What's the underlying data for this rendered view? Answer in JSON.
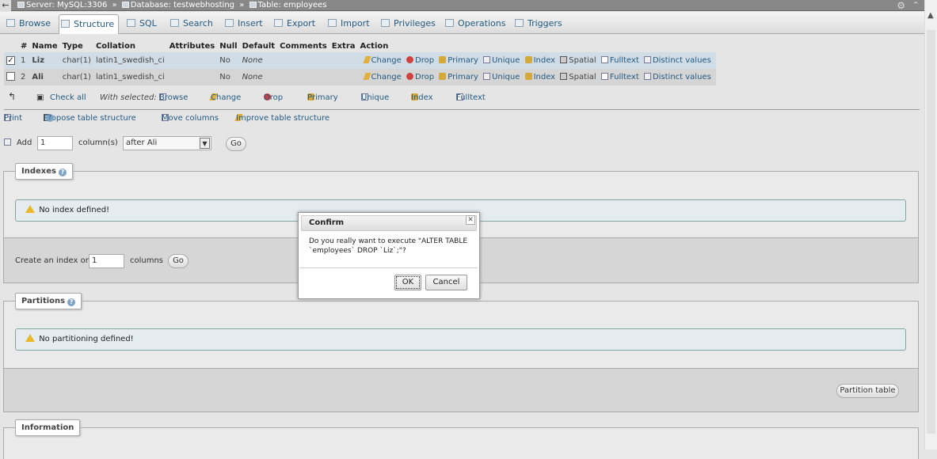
{
  "breadcrumb": {
    "back": "←",
    "server": "Server: MySQL:3306",
    "database": "Database: testwebhosting",
    "table": "Table: employees",
    "sep": "»"
  },
  "tabs": [
    {
      "label": "Browse",
      "icon": "browse-icon"
    },
    {
      "label": "Structure",
      "icon": "structure-icon",
      "active": true
    },
    {
      "label": "SQL",
      "icon": "sql-icon"
    },
    {
      "label": "Search",
      "icon": "search-icon"
    },
    {
      "label": "Insert",
      "icon": "insert-icon"
    },
    {
      "label": "Export",
      "icon": "export-icon"
    },
    {
      "label": "Import",
      "icon": "import-icon"
    },
    {
      "label": "Privileges",
      "icon": "privileges-icon"
    },
    {
      "label": "Operations",
      "icon": "operations-icon"
    },
    {
      "label": "Triggers",
      "icon": "triggers-icon"
    }
  ],
  "columns_table": {
    "headers": [
      "#",
      "Name",
      "Type",
      "Collation",
      "Attributes",
      "Null",
      "Default",
      "Comments",
      "Extra",
      "Action"
    ],
    "rows": [
      {
        "checked": true,
        "num": "1",
        "name": "Liz",
        "type": "char(1)",
        "collation": "latin1_swedish_ci",
        "attributes": "",
        "null": "No",
        "default": "None",
        "comments": "",
        "extra": ""
      },
      {
        "checked": false,
        "num": "2",
        "name": "Ali",
        "type": "char(1)",
        "collation": "latin1_swedish_ci",
        "attributes": "",
        "null": "No",
        "default": "None",
        "comments": "",
        "extra": ""
      }
    ],
    "actions": {
      "change": "Change",
      "drop": "Drop",
      "primary": "Primary",
      "unique": "Unique",
      "index": "Index",
      "spatial": "Spatial",
      "fulltext": "Fulltext",
      "distinct": "Distinct values"
    }
  },
  "with_selected": {
    "check_all": "Check all",
    "label": "With selected:",
    "browse": "Browse",
    "change": "Change",
    "drop": "Drop",
    "primary": "Primary",
    "unique": "Unique",
    "index": "Index",
    "fulltext": "Fulltext"
  },
  "tools": {
    "print": "Print",
    "propose": "Propose table structure",
    "move": "Move columns",
    "improve": "Improve table structure"
  },
  "add_columns": {
    "label": "Add",
    "count": "1",
    "unit": "column(s)",
    "position": "after Ali",
    "go": "Go"
  },
  "indexes": {
    "legend": "Indexes",
    "notice": "No index defined!",
    "create_label": "Create an index on",
    "create_count": "1",
    "create_unit": "columns",
    "go": "Go"
  },
  "partitions": {
    "legend": "Partitions",
    "notice": "No partitioning defined!",
    "button": "Partition table"
  },
  "information": {
    "legend": "Information"
  },
  "dialog": {
    "title": "Confirm",
    "message": "Do you really want to execute \"ALTER TABLE `employees` DROP `Liz`;\"?",
    "ok": "OK",
    "cancel": "Cancel"
  }
}
